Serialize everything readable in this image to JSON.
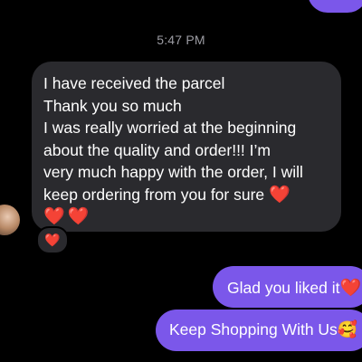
{
  "chat": {
    "timestamp": "5:47 PM",
    "incoming": {
      "lines": [
        "I have received the parcel",
        "Thank you so much",
        "I was really worried at the beginning",
        "about the quality and order!!! I’m",
        "very much happy with the order, I will",
        "keep ordering from you for sure"
      ],
      "heart_emoji": "❤️",
      "reaction": "❤️"
    },
    "outgoing": [
      {
        "text": "Glad you liked it",
        "emoji": "❤️"
      },
      {
        "text": "Keep Shopping With Us",
        "emoji": "🥰"
      }
    ]
  },
  "colors": {
    "background": "#000000",
    "incoming_bubble": "#2a2a2e",
    "outgoing_bubble": "#7b57ea",
    "timestamp_text": "#9c9ca3",
    "heart": "#ff2a2a"
  }
}
